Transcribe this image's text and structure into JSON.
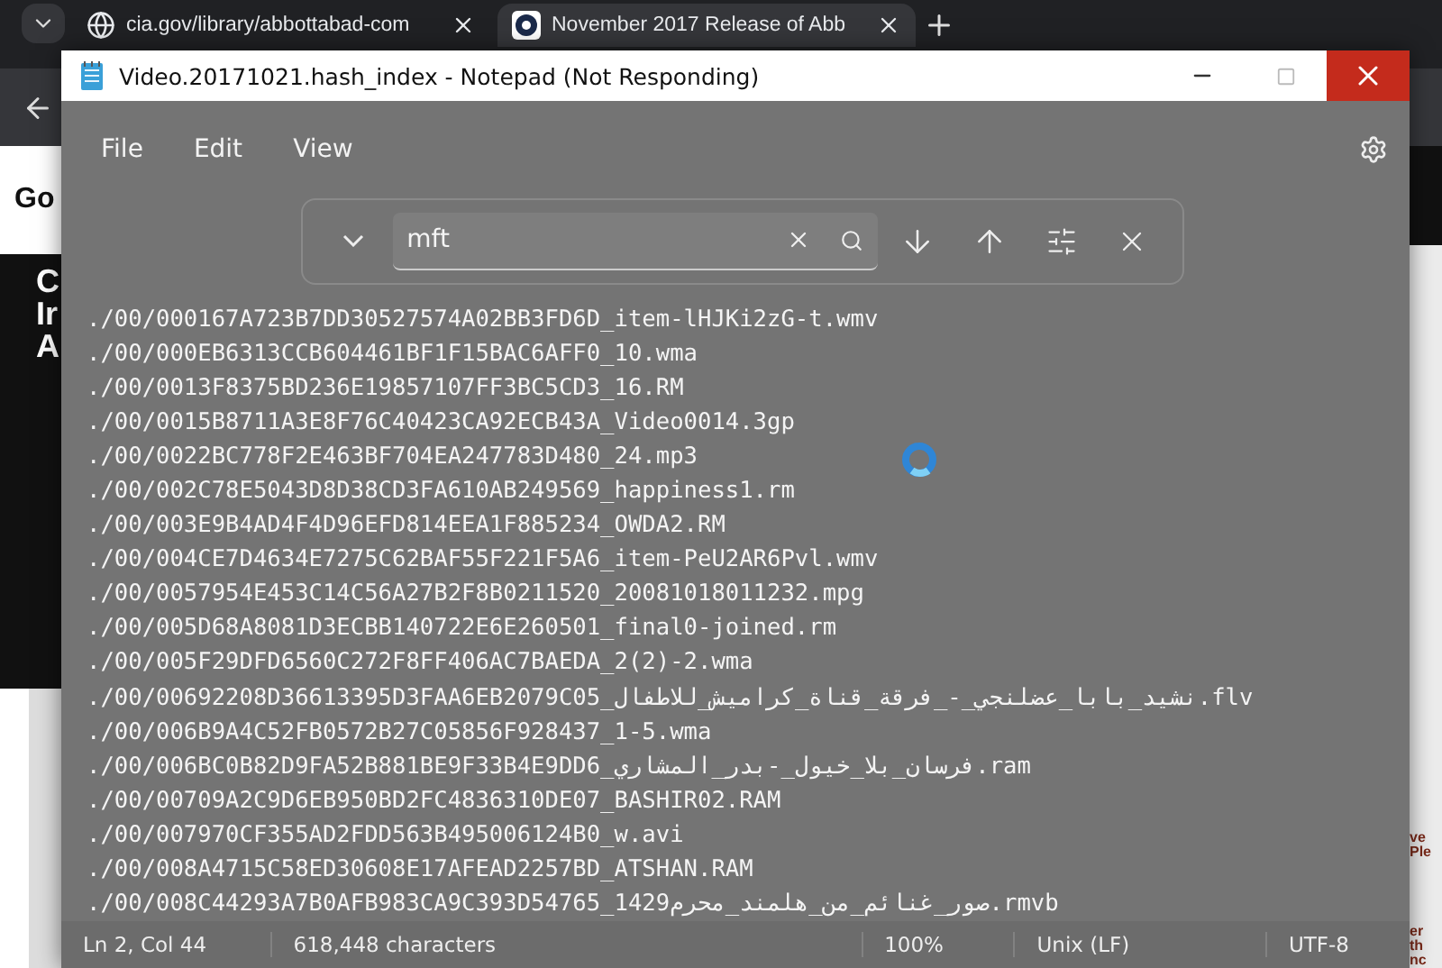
{
  "browser": {
    "tabs": [
      {
        "title": "cia.gov/library/abbottabad-com",
        "selected": false
      },
      {
        "title": "November 2017 Release of Abb",
        "selected": true
      }
    ],
    "left_fragments": [
      "Go",
      "C\nIr\nA"
    ],
    "right_fragments": [
      "ve\nPle",
      "er\nth\nnc"
    ]
  },
  "notepad": {
    "title": "Video.20171021.hash_index - Notepad (Not Responding)",
    "menu": [
      "File",
      "Edit",
      "View"
    ],
    "find": {
      "value": "mft"
    },
    "lines": [
      "./00/000167A723B7DD30527574A02BB3FD6D_item-lHJKi2zG-t.wmv",
      "./00/000EB6313CCB604461BF1F15BAC6AFF0_10.wma",
      "./00/0013F8375BD236E19857107FF3BC5CD3_16.RM",
      "./00/0015B8711A3E8F76C40423CA92ECB43A_Video0014.3gp",
      "./00/0022BC778F2E463BF704EA247783D480_24.mp3",
      "./00/002C78E5043D8D38CD3FA610AB249569_happiness1.rm",
      "./00/003E9B4AD4F4D96EFD814EEA1F885234_OWDA2.RM",
      "./00/004CE7D4634E7275C62BAF55F221F5A6_item-PeU2AR6Pvl.wmv",
      "./00/0057954E453C14C56A27B2F8B0211520_20081018011232.mpg",
      "./00/005D68A8081D3ECBB140722E6E260501_final0-joined.rm",
      "./00/005F29DFD6560C272F8FF406AC7BAEDA_2(2)-2.wma",
      "./00/00692208D36613395D3FAA6EB2079C05_نشيد_بابا_عضلنجي_-_فرقة_قناة_كراميش_للاطفال.flv",
      "./00/006B9A4C52FB0572B27C05856F928437_1-5.wma",
      "./00/006BC0B82D9FA52B881BE9F33B4E9DD6_فرسان_بلا_خيول_-بدر_المشاري.ram",
      "./00/00709A2C9D6EB950BD2FC4836310DE07_BASHIR02.RAM",
      "./00/007970CF355AD2FDD563B495006124B0_w.avi",
      "./00/008A4715C58ED30608E17AFEAD2257BD_ATSHAN.RAM",
      "./00/008C44293A7B0AFB983CA9C393D54765_1429صور_غنائم_من_هلمند_محرم.rmvb"
    ],
    "status": {
      "position": "Ln 2, Col 44",
      "characters": "618,448 characters",
      "zoom": "100%",
      "line_ending": "Unix (LF)",
      "encoding": "UTF-8"
    }
  }
}
